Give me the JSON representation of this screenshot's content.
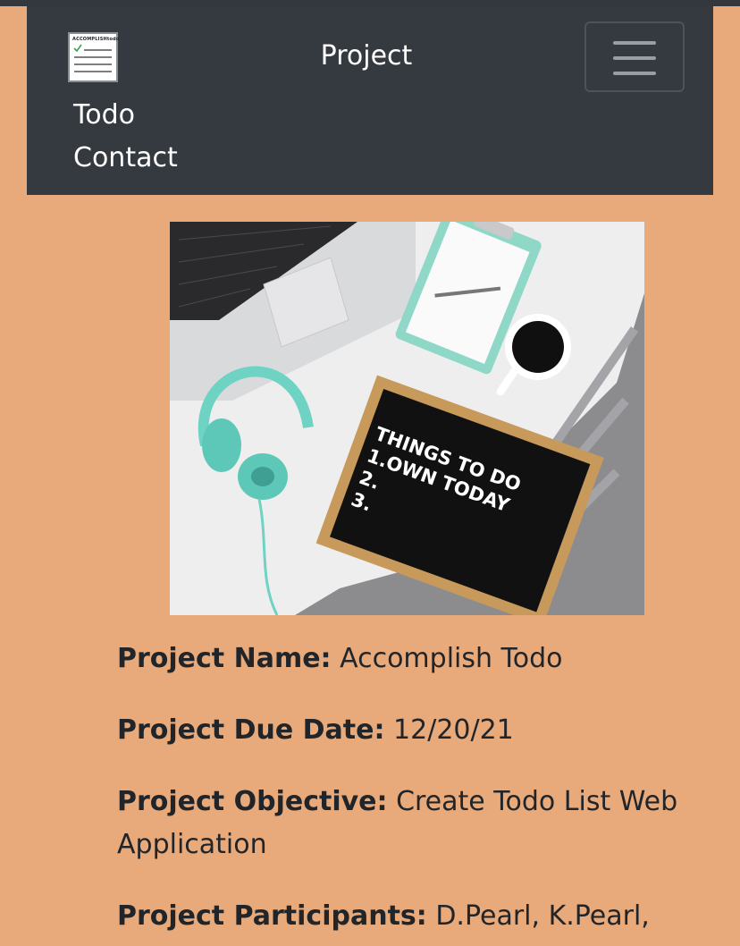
{
  "navbar": {
    "logo_text": "ACCOMPLISHtodo",
    "title": "Project",
    "links": [
      "Todo",
      "Contact"
    ],
    "toggler_icon": "hamburger-menu-icon"
  },
  "hero": {
    "board_lines": [
      "THINGS TO DO",
      "1.OWN TODAY",
      "2.",
      "3."
    ]
  },
  "project": {
    "name_label": "Project Name:",
    "name_value": "Accomplish Todo",
    "due_label": "Project Due Date:",
    "due_value": "12/20/21",
    "objective_label": "Project Objective:",
    "objective_value": "Create Todo List Web Application",
    "participants_label": "Project Participants:",
    "participants_value": "D.Pearl, K.Pearl,"
  },
  "colors": {
    "page_bg": "#e8aa7b",
    "navbar_bg": "#343a40",
    "text": "#212529"
  }
}
